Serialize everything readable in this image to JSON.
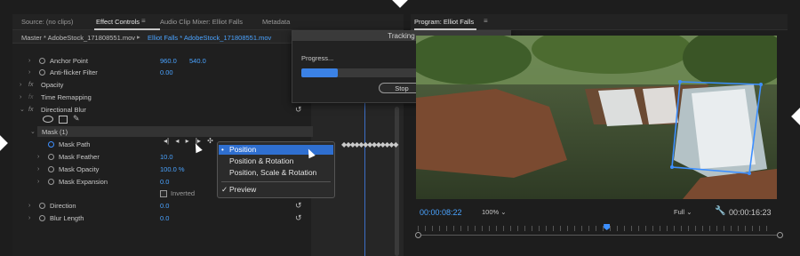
{
  "top_tabs": [
    {
      "label": "Source: (no clips)",
      "active": false
    },
    {
      "label": "Effect Controls",
      "active": true
    },
    {
      "label": "Audio Clip Mixer: Elliot Falls",
      "active": false
    },
    {
      "label": "Metadata",
      "active": false
    }
  ],
  "effect_controls": {
    "master_clip": "Master * AdobeStock_171808551.mov",
    "sequence_clip": "Elliot Falls * AdobeStock_171808551.mov",
    "rows": {
      "anchor_point": {
        "label": "Anchor Point",
        "x": "960.0",
        "y": "540.0"
      },
      "anti_flicker": {
        "label": "Anti-flicker Filter",
        "value": "0.00"
      },
      "opacity": {
        "label": "Opacity"
      },
      "time_remapping": {
        "label": "Time Remapping"
      },
      "directional_blur": {
        "label": "Directional Blur"
      },
      "mask": {
        "label": "Mask (1)"
      },
      "mask_path": {
        "label": "Mask Path"
      },
      "mask_feather": {
        "label": "Mask Feather",
        "value": "10.0"
      },
      "mask_opacity": {
        "label": "Mask Opacity",
        "value": "100.0 %"
      },
      "mask_expansion": {
        "label": "Mask Expansion",
        "value": "0.0"
      },
      "inverted": {
        "label": "Inverted"
      },
      "direction": {
        "label": "Direction",
        "value": "0.0"
      },
      "blur_length": {
        "label": "Blur Length",
        "value": "0.0"
      }
    }
  },
  "tracking_dialog": {
    "title": "Tracking",
    "progress_label": "Progress...",
    "progress": 0.18,
    "stop_label": "Stop"
  },
  "track_method_menu": {
    "items": [
      {
        "label": "Position",
        "selected": true
      },
      {
        "label": "Position & Rotation",
        "selected": false
      },
      {
        "label": "Position, Scale & Rotation",
        "selected": false
      }
    ],
    "preview": {
      "label": "Preview",
      "checked": true
    }
  },
  "program_monitor": {
    "title": "Program: Elliot Falls",
    "timecode_current": "00:00:08:22",
    "zoom": "100%",
    "resolution": "Full",
    "timecode_duration": "00:00:16:23",
    "playhead_fraction": 0.52
  },
  "colors": {
    "accent_blue": "#3d8fff",
    "value_blue": "#4aa3ff",
    "selection_blue": "#2f6fd0"
  }
}
